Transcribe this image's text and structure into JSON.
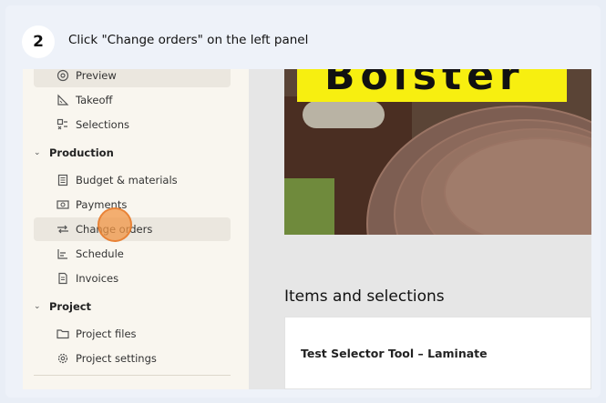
{
  "step": {
    "number": "2",
    "instruction": "Click \"Change orders\" on the left panel"
  },
  "sidebar": {
    "items": [
      {
        "label": "Preview",
        "icon": "preview-icon"
      },
      {
        "label": "Takeoff",
        "icon": "takeoff-icon"
      },
      {
        "label": "Selections",
        "icon": "selections-icon"
      }
    ],
    "production": {
      "label": "Production",
      "items": [
        {
          "label": "Budget & materials",
          "icon": "budget-icon"
        },
        {
          "label": "Payments",
          "icon": "payments-icon"
        },
        {
          "label": "Change orders",
          "icon": "change-orders-icon"
        },
        {
          "label": "Schedule",
          "icon": "schedule-icon"
        },
        {
          "label": "Invoices",
          "icon": "invoices-icon"
        }
      ]
    },
    "project": {
      "label": "Project",
      "items": [
        {
          "label": "Project files",
          "icon": "folder-icon"
        },
        {
          "label": "Project settings",
          "icon": "gear-icon"
        }
      ]
    }
  },
  "main": {
    "brand_text": "Bolster",
    "section_title": "Items and selections",
    "card_title": "Test Selector Tool – Laminate"
  },
  "colors": {
    "sidebar_bg": "#f9f6ef",
    "brand_yellow": "#f7ef10",
    "click_marker": "#f09646"
  }
}
